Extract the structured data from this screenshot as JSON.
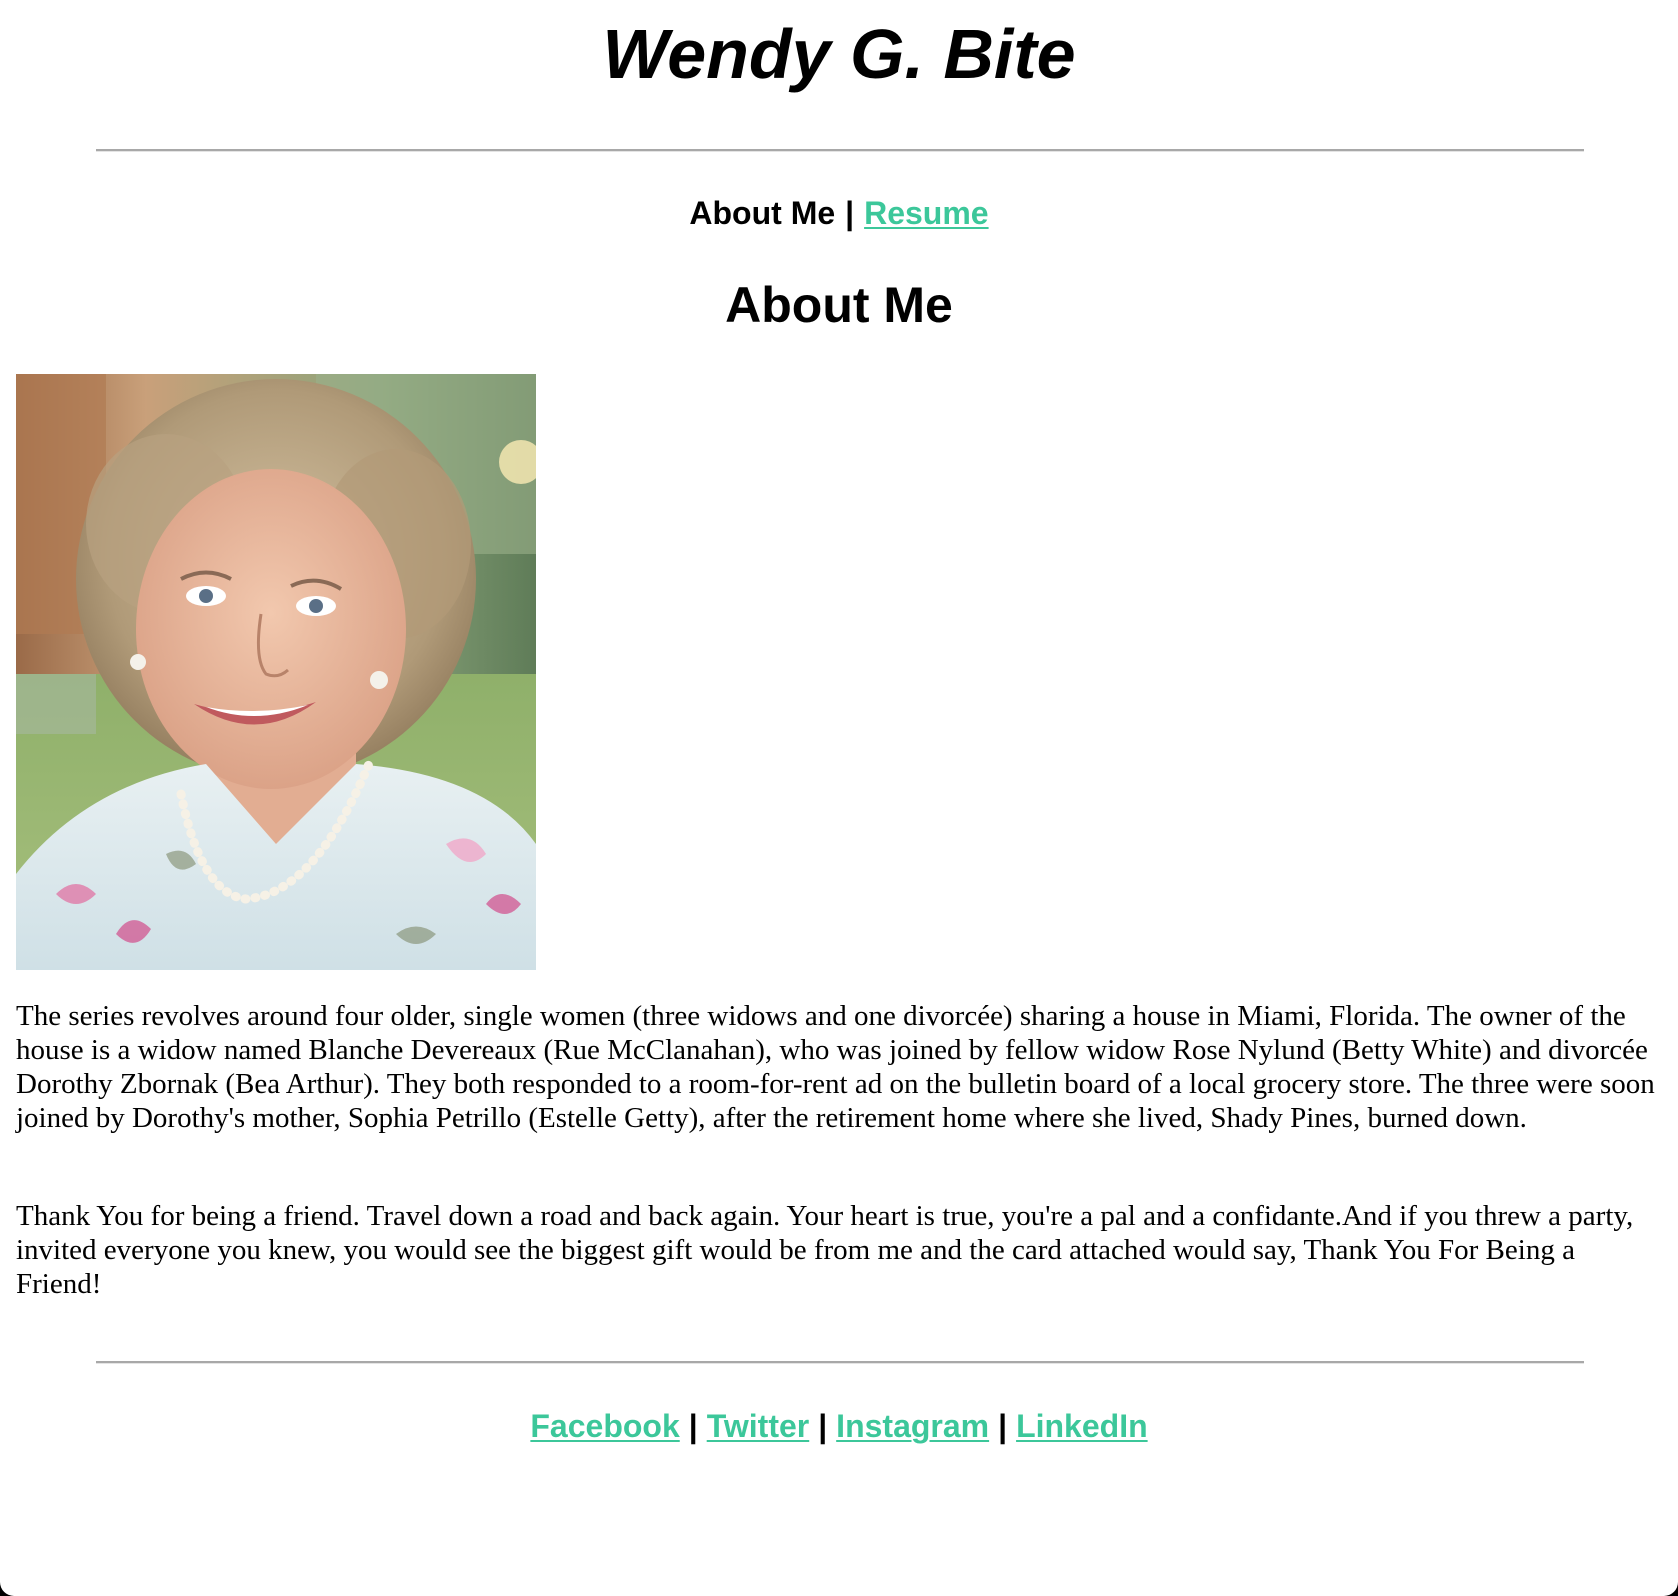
{
  "header": {
    "title": "Wendy G. Bite"
  },
  "nav": {
    "current": "About Me",
    "separator": "|",
    "resume_link": "Resume"
  },
  "main": {
    "heading": "About Me",
    "photo_icon": "portrait-photo",
    "paragraphs": [
      "The series revolves around four older, single women (three widows and one divorcée) sharing a house in Miami, Florida. The owner of the house is a widow named Blanche Devereaux (Rue McClanahan), who was joined by fellow widow Rose Nylund (Betty White) and divorcée Dorothy Zbornak (Bea Arthur). They both responded to a room-for-rent ad on the bulletin board of a local grocery store. The three were soon joined by Dorothy's mother, Sophia Petrillo (Estelle Getty), after the retirement home where she lived, Shady Pines, burned down.",
      "Thank You for being a friend. Travel down a road and back again. Your heart is true, you're a pal and a confidante.And if you threw a party, invited everyone you knew, you would see the biggest gift would be from me and the card attached would say, Thank You For Being a Friend!"
    ]
  },
  "footer": {
    "links": [
      "Facebook",
      "Twitter",
      "Instagram",
      "LinkedIn"
    ],
    "separator": "|"
  },
  "colors": {
    "link": "#3cc79a",
    "text": "#000000",
    "background": "#ffffff",
    "rule": "#a8a8a8"
  }
}
